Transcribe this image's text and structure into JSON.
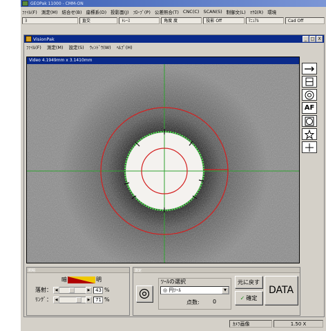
{
  "app": {
    "title": "GEOPak 11000 - CMM-ON"
  },
  "menu": [
    "ﾌｧｲﾙ(F)",
    "測定(M)",
    "結合せ(B)",
    "座標系(D)",
    "投影面(J)",
    "ﾌﾛｰﾌﾞ(P)",
    "公差照合(T)",
    "CNC(C)",
    "SCAN(S)",
    "制御文(L)",
    "ﾏｸﾛ(R)",
    "環境"
  ],
  "status_row": [
    "ﾖ",
    "直交",
    "ﾄﾚｰｽ",
    "角度 度",
    "投影 Off",
    "ﾏﾆｭｱﾙ",
    "Cad Off"
  ],
  "child_window": {
    "title": "VisionPak",
    "menu": [
      "ﾌｧｲﾙ(F)",
      "測定(M)",
      "設定(S)",
      "ｳｨﾝﾄﾞｳ(W)",
      "ﾍﾙﾌﾟ(H)"
    ],
    "buttons": [
      "_",
      "□",
      "X"
    ]
  },
  "video": {
    "label": "Video 4.1949mm x 3.1410mm"
  },
  "lighting": {
    "header": "照明",
    "dark_label": "暗",
    "bright_label": "明",
    "fall_label": "落射：",
    "fall_value": "43",
    "fall_unit": "%",
    "ring_label": "ﾘﾝｸﾞ：",
    "ring_value": "71",
    "ring_unit": "%"
  },
  "tool_panel": {
    "header": "測定",
    "select_label": "ﾂｰﾙの選択",
    "selected_tool": "◎ 円ﾂｰﾙ",
    "points_label": "点数:",
    "points_value": "0",
    "undo_label": "元に戻す",
    "confirm_label": "確定",
    "data_label": "DATA"
  },
  "statusbar": {
    "camera_label": "ｶﾒﾗ画像",
    "zoom": "1.50 X"
  },
  "colors": {
    "title_blue": "#0a2a8a",
    "crosshair": "#2fa32f",
    "circle_red": "#d42020",
    "edge_green": "#4ee04e",
    "window_gray": "#d4d0c8"
  }
}
